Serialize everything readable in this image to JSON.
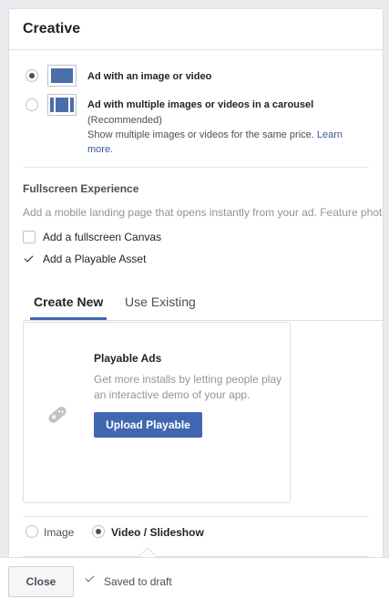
{
  "panel": {
    "title": "Creative"
  },
  "formats": [
    {
      "title": "Ad with an image or video",
      "selected": true
    },
    {
      "title": "Ad with multiple images or videos in a carousel",
      "recommended": "(Recommended)",
      "description": "Show multiple images or videos for the same price.",
      "learn_more": "Learn more.",
      "selected": false
    }
  ],
  "fullscreen": {
    "title": "Fullscreen Experience",
    "description": "Add a mobile landing page that opens instantly from your ad. Feature photos",
    "options": [
      {
        "label": "Add a fullscreen Canvas",
        "checked": false
      },
      {
        "label": "Add a Playable Asset",
        "checked": true
      }
    ]
  },
  "tabs": [
    {
      "label": "Create New",
      "active": true
    },
    {
      "label": "Use Existing",
      "active": false
    }
  ],
  "playable_card": {
    "title": "Playable Ads",
    "description": "Get more installs by letting people play an interactive demo of your app.",
    "button": "Upload Playable",
    "icon": "gamepad-icon"
  },
  "media_type": {
    "options": [
      {
        "label": "Image",
        "selected": false
      },
      {
        "label": "Video / Slideshow",
        "selected": true
      }
    ]
  },
  "footer": {
    "close_label": "Close",
    "status": "Saved to draft"
  },
  "colors": {
    "accent": "#4267b2",
    "link": "#365899",
    "thumb": "#4a6ea9"
  }
}
